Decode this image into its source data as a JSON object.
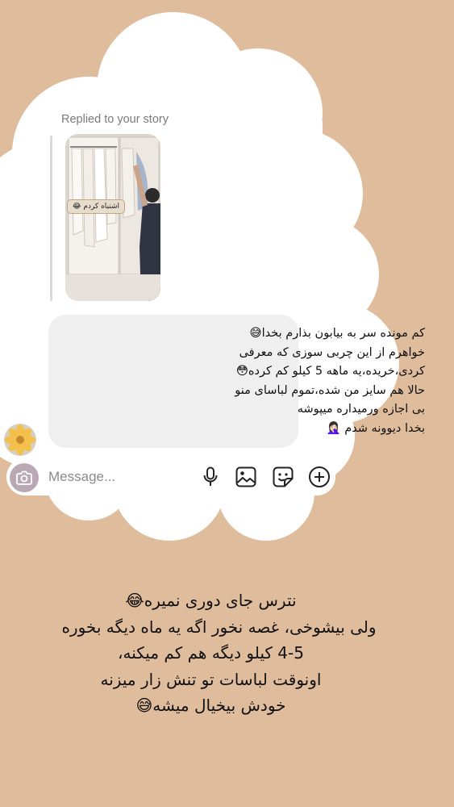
{
  "story_reply": {
    "replied_label": "Replied to your story",
    "story_sticker_text": "اشتباه کردم 😂"
  },
  "message": {
    "lines": [
      "کم مونده سر به بیابون بذارم بخدا😅",
      "خواهرم از این چربی سوزی که معرفی",
      "کردی،خریده،یه ماهه 5 کیلو کم کرده😳",
      "حالا هم سایز من شده،تموم لباسای منو",
      "بی اجازه ورمیداره میپوشه",
      "بخدا دیوونه  شدم 🤦🏻‍♀️"
    ]
  },
  "composer": {
    "placeholder": "Message..."
  },
  "caption": {
    "lines": [
      "نترس جای دوری نمیره😂",
      "ولی بیشوخی، غصه نخور اگه یه ماه دیگه بخوره",
      "4-5 کیلو دیگه هم کم میکنه،",
      "اونوقت لباسات تو تنش زار میزنه",
      "خودش بیخیال میشه😅"
    ]
  },
  "colors": {
    "background": "#dfbc9b",
    "cloud": "#ffffff",
    "bubble": "#efefef"
  },
  "icons": [
    "camera-icon",
    "microphone-icon",
    "gallery-icon",
    "sticker-icon",
    "plus-circle-icon"
  ]
}
